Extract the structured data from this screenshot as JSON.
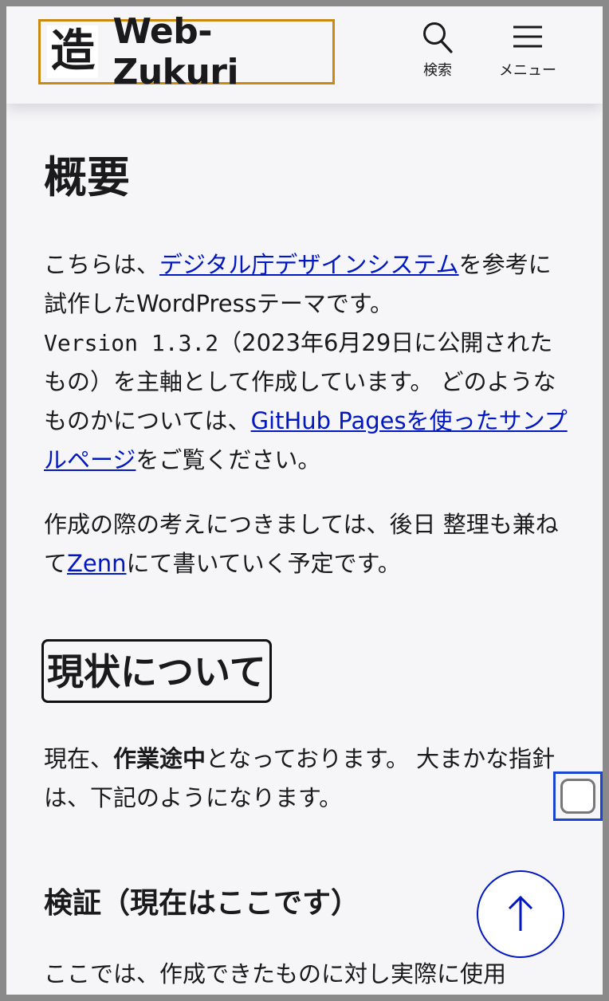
{
  "header": {
    "logo_mark": "造",
    "logo_text": "Web-Zukuri",
    "search_label": "検索",
    "menu_label": "メニュー"
  },
  "overview": {
    "heading": "概要",
    "p1_a": "こちらは、",
    "p1_link1": "デジタル庁デザインシステム",
    "p1_b": "を参考に試作したWordPressテーマです。",
    "p1_code": "Version 1.3.2",
    "p1_c": "（2023年6月29日に公開されたもの）を主軸として作成しています。 どのようなものかについては、",
    "p1_link2": "GitHub Pagesを使ったサンプルページ",
    "p1_d": "をご覧ください。",
    "p2_a": "作成の際の考えにつきましては、後日 整理も兼ねて",
    "p2_link": "Zenn",
    "p2_b": "にて書いていく予定です。"
  },
  "current": {
    "heading": "現状について",
    "p_a": "現在、",
    "p_bold": "作業途中",
    "p_b": "となっております。 大まかな指針は、下記のようになります。"
  },
  "verify": {
    "heading": "検証（現在はここです）",
    "p": "ここでは、作成できたものに対し実際に使用"
  },
  "colors": {
    "link": "#0017c1",
    "logo_border": "#c98a14",
    "background": "#f6f6f9"
  },
  "icons": [
    "search-icon",
    "hamburger-menu-icon",
    "arrow-up-icon"
  ]
}
